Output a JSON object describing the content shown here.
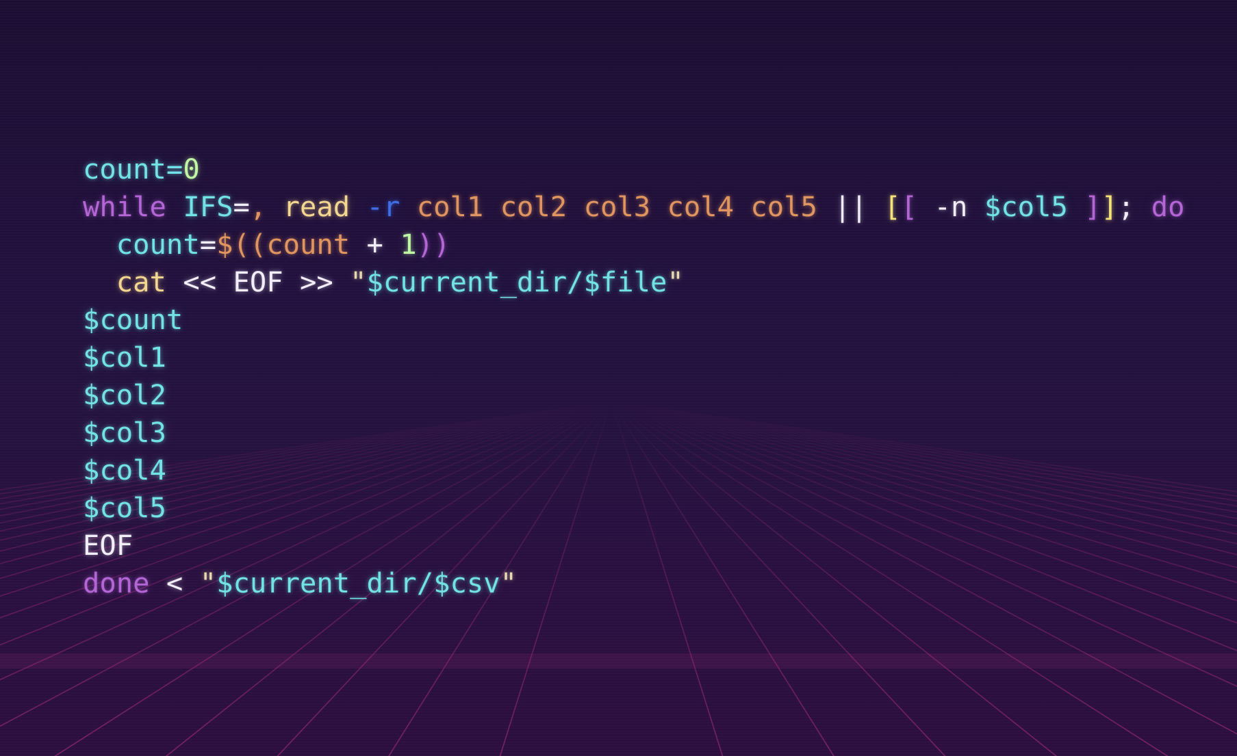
{
  "editor": {
    "language": "bash",
    "theme": "synthwave",
    "background_color": "#1d0f35",
    "grid_color": "#c2308f"
  },
  "code_lines": [
    [
      {
        "text": "count=",
        "role": "var"
      },
      {
        "text": "0",
        "role": "num"
      }
    ],
    [
      {
        "text": "while",
        "role": "kw"
      },
      {
        "text": " ",
        "role": "plain"
      },
      {
        "text": "IFS",
        "role": "var"
      },
      {
        "text": "=",
        "role": "plain"
      },
      {
        "text": ",",
        "role": "arg"
      },
      {
        "text": " ",
        "role": "plain"
      },
      {
        "text": "read",
        "role": "cmd"
      },
      {
        "text": " ",
        "role": "plain"
      },
      {
        "text": "-r",
        "role": "flag"
      },
      {
        "text": " col1 col2 col3 col4 col5",
        "role": "arg"
      },
      {
        "text": " || ",
        "role": "plain"
      },
      {
        "text": "[",
        "role": "br1"
      },
      {
        "text": "[",
        "role": "br2"
      },
      {
        "text": " -n ",
        "role": "plain"
      },
      {
        "text": "$col5",
        "role": "var"
      },
      {
        "text": " ]",
        "role": "br2"
      },
      {
        "text": "]",
        "role": "br1"
      },
      {
        "text": "; ",
        "role": "plain"
      },
      {
        "text": "do",
        "role": "kw"
      }
    ],
    [
      {
        "text": "  ",
        "role": "plain"
      },
      {
        "text": "count",
        "role": "var"
      },
      {
        "text": "=",
        "role": "plain"
      },
      {
        "text": "$((",
        "role": "arg"
      },
      {
        "text": "count",
        "role": "arg"
      },
      {
        "text": " + ",
        "role": "plain"
      },
      {
        "text": "1",
        "role": "num"
      },
      {
        "text": "))",
        "role": "br2"
      }
    ],
    [
      {
        "text": "  ",
        "role": "plain"
      },
      {
        "text": "cat",
        "role": "cmd"
      },
      {
        "text": " << EOF >> ",
        "role": "plain"
      },
      {
        "text": "\"",
        "role": "str"
      },
      {
        "text": "$current_dir/$file",
        "role": "var"
      },
      {
        "text": "\"",
        "role": "str"
      }
    ],
    [
      {
        "text": "$count",
        "role": "var"
      }
    ],
    [
      {
        "text": "$col1",
        "role": "var"
      }
    ],
    [
      {
        "text": "$col2",
        "role": "var"
      }
    ],
    [
      {
        "text": "$col3",
        "role": "var"
      }
    ],
    [
      {
        "text": "$col4",
        "role": "var"
      }
    ],
    [
      {
        "text": "$col5",
        "role": "var"
      }
    ],
    [
      {
        "text": "EOF",
        "role": "plain"
      }
    ],
    [
      {
        "text": "done",
        "role": "kw"
      },
      {
        "text": " < ",
        "role": "plain"
      },
      {
        "text": "\"",
        "role": "str"
      },
      {
        "text": "$current_dir/$csv",
        "role": "var"
      },
      {
        "text": "\"",
        "role": "str"
      }
    ]
  ]
}
